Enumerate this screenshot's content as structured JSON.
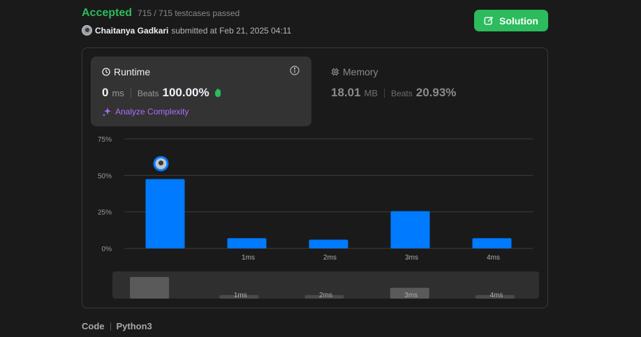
{
  "header": {
    "status": "Accepted",
    "testcases": "715 / 715 testcases passed",
    "submitter_name": "Chaitanya Gadkari",
    "submitted_text": "submitted at Feb 21, 2025 04:11",
    "solution_label": "Solution"
  },
  "runtime": {
    "title": "Runtime",
    "value": "0",
    "unit": "ms",
    "beats_label": "Beats",
    "beats_pct": "100.00%",
    "analyze_label": "Analyze Complexity"
  },
  "memory": {
    "title": "Memory",
    "value": "18.01",
    "unit": "MB",
    "beats_label": "Beats",
    "beats_pct": "20.93%"
  },
  "chart_data": {
    "type": "bar",
    "categories": [
      "",
      "1ms",
      "2ms",
      "3ms",
      "4ms"
    ],
    "values": [
      47.5,
      7,
      6,
      25.5,
      7
    ],
    "ylim": [
      0,
      75
    ],
    "yticks": [
      "0%",
      "25%",
      "50%",
      "75%"
    ],
    "ytick_values": [
      0,
      25,
      50,
      75
    ],
    "grid": true,
    "highlight_index": 0,
    "bar_color": "#007aff",
    "brush": {
      "values": [
        15,
        2.5,
        2.5,
        7.5,
        2.5
      ],
      "labels": [
        "",
        "1ms",
        "2ms",
        "3ms",
        "4ms"
      ],
      "color_selected": "#5a5a5a",
      "color_other": "#4a4a4a"
    }
  },
  "footer": {
    "code_label": "Code",
    "language": "Python3"
  },
  "colors": {
    "accent": "#2cbb5d",
    "purple": "#a970ff",
    "bar": "#007aff"
  }
}
